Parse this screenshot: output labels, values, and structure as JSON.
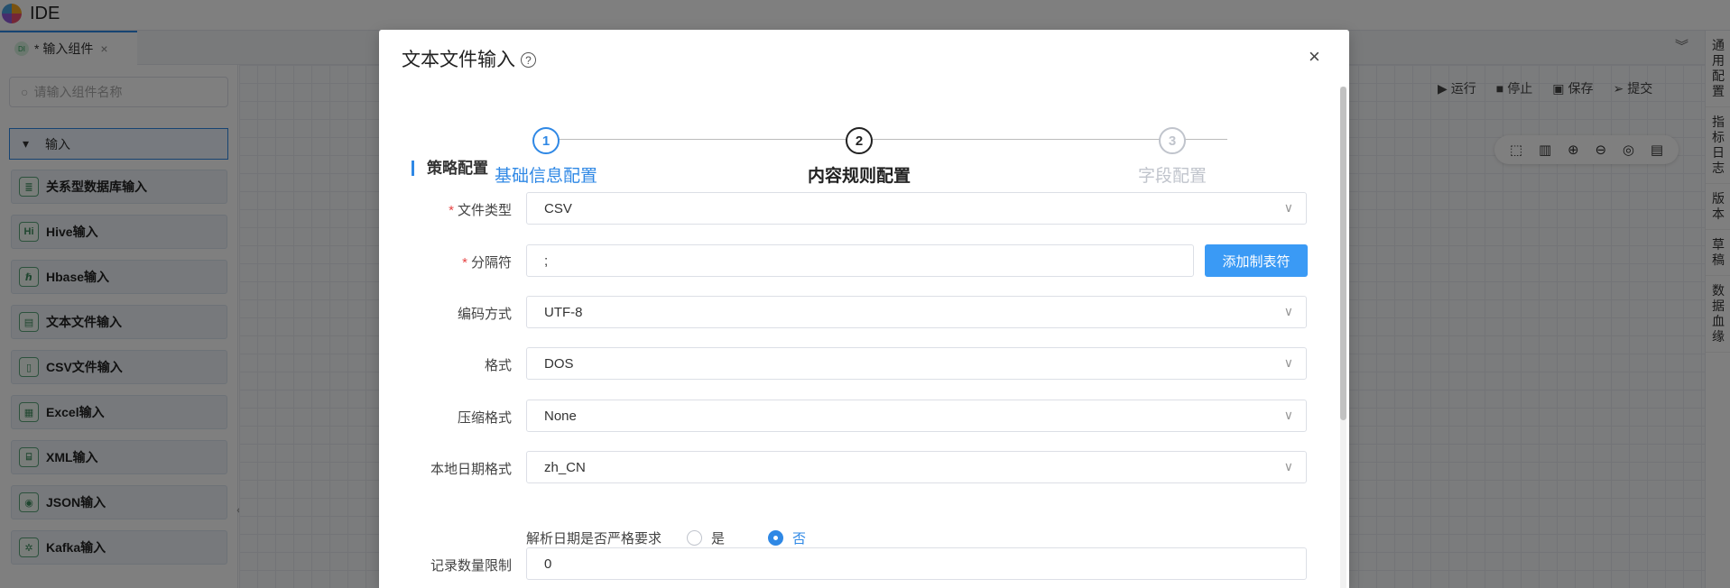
{
  "app": {
    "title": "IDE"
  },
  "tab": {
    "badge": "DI",
    "name": "* 输入组件",
    "close": "×"
  },
  "left_panel": {
    "search_placeholder": "请输入组件名称",
    "group": "输入",
    "items": [
      {
        "label": "关系型数据库输入",
        "icon": "database-icon",
        "glyph": "≣"
      },
      {
        "label": "Hive输入",
        "icon": "hive-icon",
        "glyph": "Hi"
      },
      {
        "label": "Hbase输入",
        "icon": "hbase-icon",
        "glyph": "ℏ"
      },
      {
        "label": "文本文件输入",
        "icon": "text-file-icon",
        "glyph": "▤"
      },
      {
        "label": "CSV文件输入",
        "icon": "csv-file-icon",
        "glyph": "▯"
      },
      {
        "label": "Excel输入",
        "icon": "excel-icon",
        "glyph": "▦"
      },
      {
        "label": "XML输入",
        "icon": "xml-icon",
        "glyph": "⌸"
      },
      {
        "label": "JSON输入",
        "icon": "json-icon",
        "glyph": "◉"
      },
      {
        "label": "Kafka输入",
        "icon": "kafka-icon",
        "glyph": "✲"
      }
    ]
  },
  "toolbar": {
    "run": "运行",
    "stop": "停止",
    "save": "保存",
    "submit": "提交"
  },
  "right_rail": [
    "通用配置",
    "指标日志",
    "版本",
    "草稿",
    "数据血缘"
  ],
  "modal": {
    "title": "文本文件输入",
    "steps": [
      {
        "num": "1",
        "label": "基础信息配置",
        "state": "done"
      },
      {
        "num": "2",
        "label": "内容规则配置",
        "state": "active"
      },
      {
        "num": "3",
        "label": "字段配置",
        "state": "todo"
      }
    ],
    "section": "策略配置",
    "fields": {
      "file_type": {
        "label": "文件类型",
        "value": "CSV"
      },
      "separator": {
        "label": "分隔符",
        "value": ";",
        "button": "添加制表符"
      },
      "encoding": {
        "label": "编码方式",
        "value": "UTF-8"
      },
      "format": {
        "label": "格式",
        "value": "DOS"
      },
      "compression": {
        "label": "压缩格式",
        "value": "None"
      },
      "locale_date": {
        "label": "本地日期格式",
        "value": "zh_CN"
      },
      "strict_date": {
        "label": "解析日期是否严格要求",
        "options": [
          "是",
          "否"
        ],
        "selected": "否"
      },
      "record_limit": {
        "label": "记录数量限制",
        "value": "0"
      }
    }
  }
}
